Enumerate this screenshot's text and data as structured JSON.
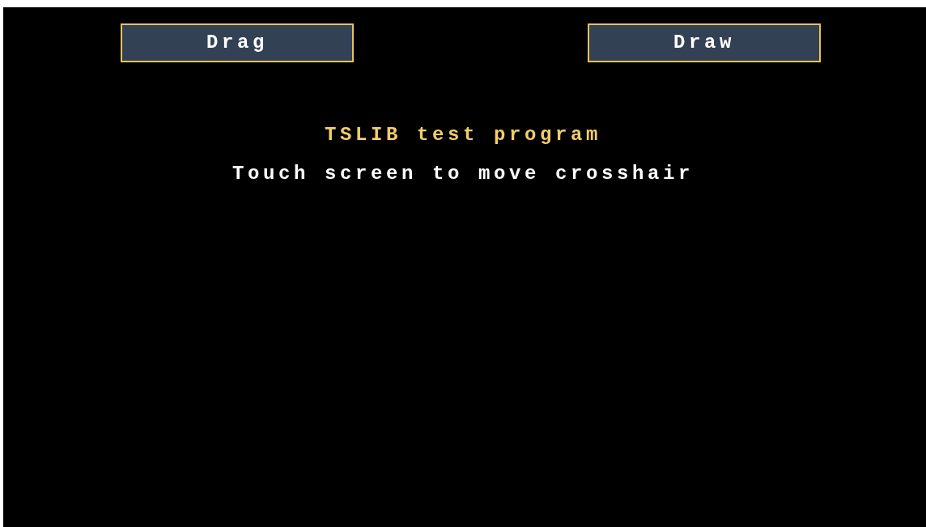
{
  "buttons": [
    {
      "label": "Drag"
    },
    {
      "label": "Draw"
    }
  ],
  "title": "TSLIB test program",
  "instruction": "Touch screen to move crosshair"
}
